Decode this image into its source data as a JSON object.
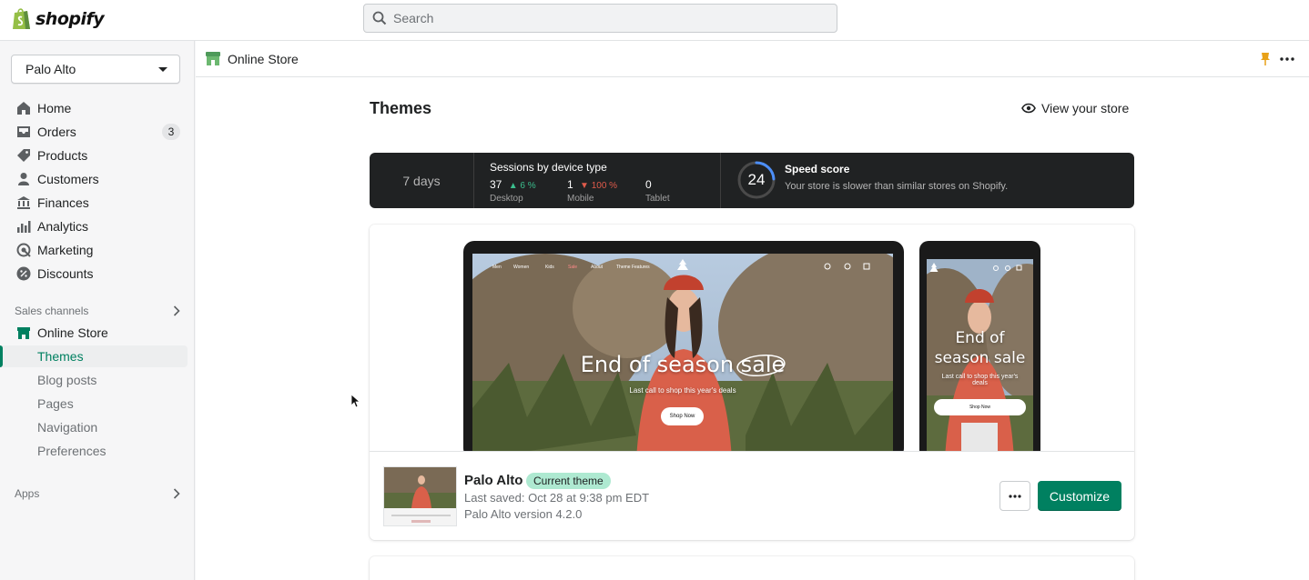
{
  "topbar": {
    "brand": "shopify",
    "search_placeholder": "Search"
  },
  "sidebar": {
    "store_name": "Palo Alto",
    "items": [
      {
        "label": "Home",
        "icon": "home-icon"
      },
      {
        "label": "Orders",
        "icon": "orders-icon",
        "badge": "3"
      },
      {
        "label": "Products",
        "icon": "tag-icon"
      },
      {
        "label": "Customers",
        "icon": "person-icon"
      },
      {
        "label": "Finances",
        "icon": "bank-icon"
      },
      {
        "label": "Analytics",
        "icon": "bar-chart-icon"
      },
      {
        "label": "Marketing",
        "icon": "target-icon"
      },
      {
        "label": "Discounts",
        "icon": "discount-icon"
      }
    ],
    "sales_channels_label": "Sales channels",
    "online_store_label": "Online Store",
    "sub_items": [
      "Themes",
      "Blog posts",
      "Pages",
      "Navigation",
      "Preferences"
    ],
    "apps_label": "Apps"
  },
  "main": {
    "bar_title": "Online Store",
    "page_title": "Themes",
    "view_store": "View your store"
  },
  "stats": {
    "period": "7 days",
    "sessions_title": "Sessions by device type",
    "devices": [
      {
        "value": "37",
        "change": "6 %",
        "direction": "up",
        "label": "Desktop"
      },
      {
        "value": "1",
        "change": "100 %",
        "direction": "down",
        "label": "Mobile"
      },
      {
        "value": "0",
        "change": "",
        "direction": "none",
        "label": "Tablet"
      }
    ],
    "speed_score": "24",
    "speed_score_value": 24,
    "speed_title": "Speed score",
    "speed_desc": "Your store is slower than similar stores on Shopify."
  },
  "preview": {
    "nav": [
      "Men",
      "Women",
      "Kids",
      "Sale",
      "About",
      "Theme Features"
    ],
    "headline": "End of season sale",
    "headline_mobile_line1": "End of",
    "headline_mobile_line2": "season sale",
    "subline": "Last call to shop this year's deals",
    "button": "Shop Now"
  },
  "theme": {
    "name": "Palo Alto",
    "badge": "Current theme",
    "last_saved": "Last saved: Oct 28 at 9:38 pm EDT",
    "version": "Palo Alto version 4.2.0",
    "customize_label": "Customize"
  },
  "colors": {
    "accent": "#008060",
    "badge_bg": "#aee9d1",
    "stats_bg": "#202223"
  }
}
